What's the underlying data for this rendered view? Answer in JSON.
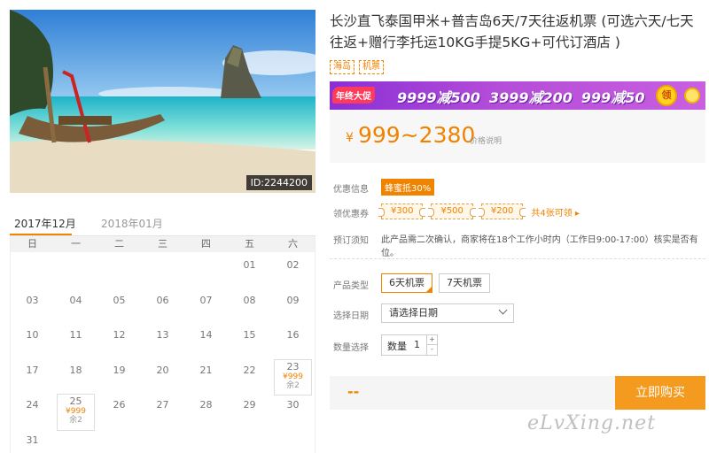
{
  "hero": {
    "id_label": "ID:2244200"
  },
  "calendar": {
    "tabs": [
      {
        "label": "2017年12月"
      },
      {
        "label": "2018年01月"
      }
    ],
    "weekdays": [
      "日",
      "一",
      "二",
      "三",
      "四",
      "五",
      "六"
    ],
    "cells": [
      {
        "day": ""
      },
      {
        "day": ""
      },
      {
        "day": ""
      },
      {
        "day": ""
      },
      {
        "day": ""
      },
      {
        "day": "01"
      },
      {
        "day": "02"
      },
      {
        "day": "03"
      },
      {
        "day": "04"
      },
      {
        "day": "05"
      },
      {
        "day": "06"
      },
      {
        "day": "07"
      },
      {
        "day": "08"
      },
      {
        "day": "09"
      },
      {
        "day": "10"
      },
      {
        "day": "11"
      },
      {
        "day": "12"
      },
      {
        "day": "13"
      },
      {
        "day": "14"
      },
      {
        "day": "15"
      },
      {
        "day": "16"
      },
      {
        "day": "17"
      },
      {
        "day": "18"
      },
      {
        "day": "19"
      },
      {
        "day": "20"
      },
      {
        "day": "21"
      },
      {
        "day": "22"
      },
      {
        "day": "23",
        "price": "¥999",
        "left": "余2"
      },
      {
        "day": "24"
      },
      {
        "day": "25",
        "price": "¥999",
        "left": "余2"
      },
      {
        "day": "26"
      },
      {
        "day": "27"
      },
      {
        "day": "28"
      },
      {
        "day": "29"
      },
      {
        "day": "30"
      },
      {
        "day": "31"
      }
    ]
  },
  "product": {
    "title": "长沙直飞泰国甲米+普吉岛6天/7天往返机票 (可选六天/七天往返+赠行李托运10KG手提5KG+可代订酒店 )",
    "tags": [
      "海岛",
      "机票"
    ]
  },
  "banner": {
    "label": "年终大促",
    "offers": [
      "9999减500",
      "3999减200",
      "999减50"
    ],
    "coin": "领"
  },
  "price": {
    "symbol": "¥",
    "range": "999~2380",
    "note": "价格说明"
  },
  "promo": {
    "label": "优惠信息",
    "discount": "蜂蜜抵30%",
    "coupon_label": "领优惠券",
    "coupons": [
      "¥300",
      "¥500",
      "¥200"
    ],
    "coupon_more": "共4张可领 ▸"
  },
  "booking_notice": {
    "label": "预订须知",
    "text": "此产品需二次确认，商家将在18个工作小时内（工作日9:00-17:00）核实是否有位。"
  },
  "options": {
    "type_label": "产品类型",
    "types": [
      "6天机票",
      "7天机票"
    ],
    "date_label": "选择日期",
    "date_placeholder": "请选择日期",
    "qty_row_label": "数量选择",
    "qty_label": "数量",
    "qty_value": "1",
    "qty_up": "+",
    "qty_down": "-"
  },
  "buy": {
    "total": "--",
    "button": "立即购买"
  },
  "watermark": "eLvXing.net",
  "colors": {
    "accent": "#f08300",
    "banner": "#8a2fd6",
    "buy": "#f39a1f"
  }
}
